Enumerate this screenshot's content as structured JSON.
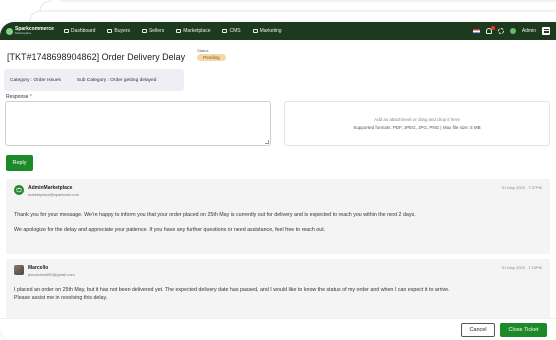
{
  "app": {
    "logo_name": "Sparkcommerce",
    "logo_sub": "Marketplace"
  },
  "nav": [
    {
      "label": "Dashboard",
      "icon": "dashboard-icon"
    },
    {
      "label": "Buyers",
      "icon": "buyers-icon"
    },
    {
      "label": "Sellers",
      "icon": "sellers-icon"
    },
    {
      "label": "Marketplace",
      "icon": "marketplace-icon"
    },
    {
      "label": "CMS",
      "icon": "cms-icon"
    },
    {
      "label": "Marketing",
      "icon": "marketing-icon"
    }
  ],
  "topbar_right": {
    "user": "Admin"
  },
  "ticket": {
    "title": "[TKT#1748698904862] Order Delivery Delay",
    "status_label": "Status",
    "status": "Pending"
  },
  "category": {
    "category": "Category : Order Issues",
    "subcategory": "Sub Category : Order getting delayed"
  },
  "response": {
    "label": "Response",
    "required_mark": "*",
    "value": ""
  },
  "dropzone": {
    "hint": "Add as attachment or drag and drop it here",
    "formats": "Supported formats: PDF, JPEG, JPG, PNG | Max file size: 5 MB"
  },
  "buttons": {
    "reply": "Reply",
    "cancel": "Cancel",
    "close_ticket": "Close Ticket"
  },
  "messages": [
    {
      "author": "AdminMarketplace",
      "email": "marketplace@sparkcart.com",
      "date": "31 May 2025 , 7:37PM",
      "paragraphs": [
        "Thank you for your message. We're happy to inform you that your order placed on 25th May is currently out for delivery and is expected to reach you within the next 2 days.",
        "We apologize for the delay and appreciate your patience. If you have any further questions or need assistance, feel free to reach out."
      ]
    },
    {
      "author": "Marcello",
      "email": "piccolotenti90@gmail.com",
      "date": "31 May 2025 , 7:15PM",
      "paragraphs": [
        "I placed an order on 25th May, but it has not been delivered yet. The expected delivery date has passed, and I would like to know the status of my order and when I can expect it to arrive.",
        "Please assist me in resolving this delay."
      ]
    }
  ],
  "colors": {
    "topbar": "#1e3a1e",
    "accent": "#1d8a2a",
    "status_pill": "#f7d7a8",
    "category_box": "#eeeef4"
  }
}
